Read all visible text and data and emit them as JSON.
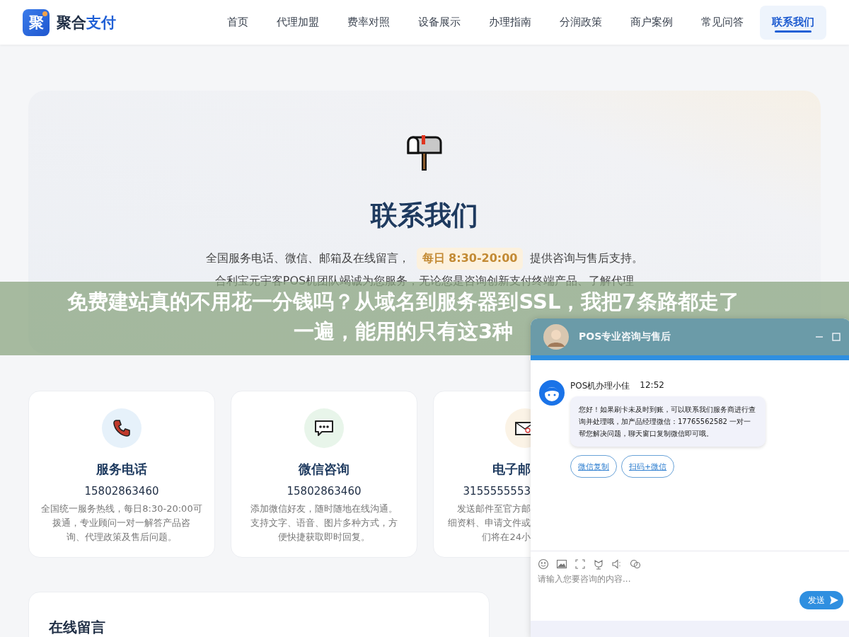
{
  "brand": {
    "icon_text": "聚",
    "name_main": "聚合",
    "name_accent": "支付"
  },
  "nav": [
    {
      "label": "首页",
      "selected": false
    },
    {
      "label": "代理加盟",
      "selected": false
    },
    {
      "label": "费率对照",
      "selected": false
    },
    {
      "label": "设备展示",
      "selected": false
    },
    {
      "label": "办理指南",
      "selected": false
    },
    {
      "label": "分润政策",
      "selected": false
    },
    {
      "label": "商户案例",
      "selected": false
    },
    {
      "label": "常见问答",
      "selected": false
    },
    {
      "label": "联系我们",
      "selected": true
    }
  ],
  "hero": {
    "title": "联系我们",
    "intro_before": "全国服务电话、微信、邮箱及在线留言，",
    "hours_label": "每日",
    "hours": "8:30-20:00",
    "intro_after": "提供咨询与售后支持。",
    "paragraph": "合利宝元宇客POS机团队竭诚为您服务，无论您是咨询创新支付终端产品、了解代理"
  },
  "cards": [
    {
      "kind": "phone",
      "title": "服务电话",
      "value": "15802863460",
      "lines": [
        "全国统一服务热线，每日8:30-20:00可",
        "拨通，专业顾问一对一解答产品咨",
        "询、代理政策及售后问题。"
      ]
    },
    {
      "kind": "chat",
      "title": "微信咨询",
      "value": "15802863460",
      "lines": [
        "添加微信好友，随时随地在线沟通。",
        "支持文字、语音、图片多种方式，方",
        "便快捷获取即时回复。"
      ]
    },
    {
      "kind": "mail",
      "title": "电子邮",
      "value": "3155555553",
      "lines": [
        "发送邮件至官方邮",
        "细资料、申请文件或",
        "们将在24小"
      ]
    }
  ],
  "message_section": {
    "title": "在线留言"
  },
  "chat": {
    "title": "POS专业咨询与售后",
    "agent": "POS机办理小佳",
    "time": "12:52",
    "message": "您好！如果刷卡未及时到账，可以联系我们服务商进行查询并处理哦，加产品经理微信：17765562582 一对一帮您解决问题，聊天窗口复制微信即可哦。",
    "actions": [
      "微信复制",
      "扫码+微信"
    ],
    "placeholder": "请输入您要咨询的内容...",
    "send": "发送"
  },
  "banner": {
    "lines": [
      "免费建站真的不用花一分钱吗？从域名到服务器到SSL，我把7条路都走了",
      "一遍，能用的只有这3种"
    ]
  }
}
